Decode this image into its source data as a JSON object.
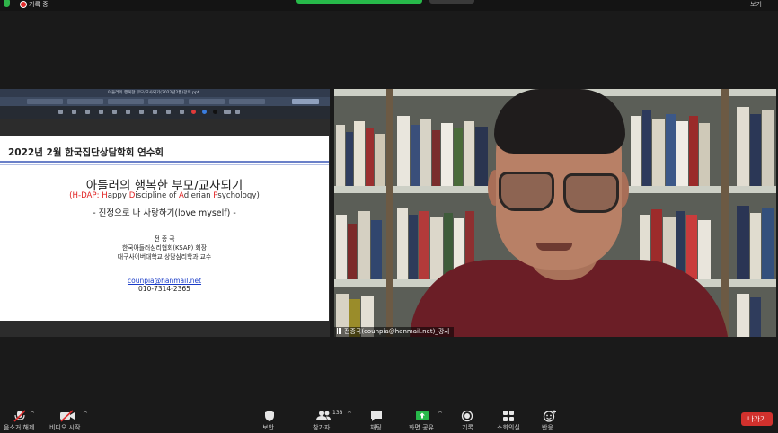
{
  "top_bar": {
    "recording_label": "기록 중",
    "view_label": "보기"
  },
  "shared_screen": {
    "window_title": "아들러의 행복한 부모/교사되기(2022년2월)강의.ppt",
    "slide": {
      "header": "2022년 2월 한국집단상담학회 연수회",
      "title": "아들러의 행복한 부모/교사되기",
      "subtitle_parts": [
        "(",
        "H-DAP",
        ": ",
        "H",
        "appy ",
        "D",
        "iscipline of ",
        "A",
        "dlerian ",
        "P",
        "sychology)"
      ],
      "line3": "- 진정으로 나 사랑하기(love myself) -",
      "author_name": "전 종 국",
      "author_role1": "한국아들러심리협회(KSAP) 회장",
      "author_role2": "대구사이버대학교 상담심리학과 교수",
      "email": "counpia@hanmail.net",
      "phone": "010-7314-2365"
    }
  },
  "video": {
    "participant_name": "전종국(counpia@hanmail.net)_강사"
  },
  "toolbar": {
    "mute_label": "음소거 해제",
    "video_label": "비디오 시작",
    "security_label": "보안",
    "participants_label": "참가자",
    "participants_count": "138",
    "chat_label": "채팅",
    "share_label": "화면 공유",
    "record_label": "기록",
    "breakout_label": "소회의실",
    "reactions_label": "반응",
    "leave_label": "나가기"
  },
  "colors": {
    "share_green": "#27b94a",
    "leave_red": "#d1312d",
    "mute_red": "#e02c2c"
  }
}
